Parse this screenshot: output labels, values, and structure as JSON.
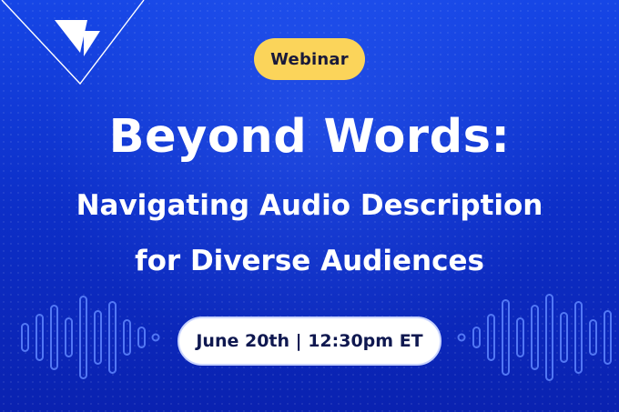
{
  "logo": {
    "icon": "v-triangle-logo-icon"
  },
  "badge": {
    "label": "Webinar",
    "color": "#fbd45a"
  },
  "title": "Beyond Words:",
  "subtitle_line1": "Navigating Audio Description",
  "subtitle_line2": "for Diverse Audiences",
  "date": "June 20th | 12:30pm ET",
  "colors": {
    "background": "#0d2fc8",
    "text": "#ffffff",
    "wave_lines": "#5f86ff"
  },
  "decor": {
    "waveform_icon": "audio-waveform-icon"
  }
}
